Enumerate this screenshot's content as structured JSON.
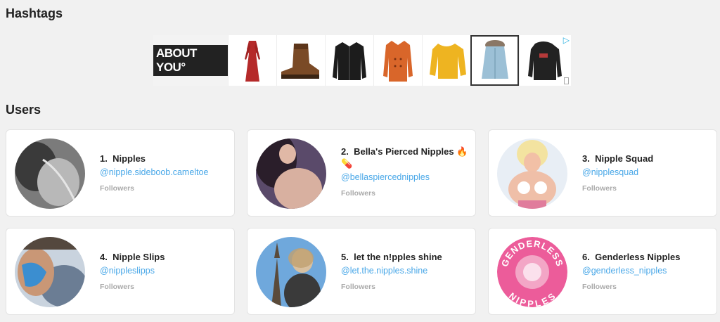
{
  "sections": {
    "hashtags_title": "Hashtags",
    "users_title": "Users"
  },
  "ad": {
    "brand_logo": "ABOUT YOU°",
    "items": [
      "red-dress",
      "brown-boot",
      "black-leather-jacket",
      "orange-coat",
      "yellow-sweater",
      "light-blue-parka",
      "black-winter-jacket"
    ],
    "selected_index": 5
  },
  "users": [
    {
      "rank": "1.",
      "name": "Nipples",
      "handle": "@nipple.sideboob.cameltoe",
      "followers_label": "Followers"
    },
    {
      "rank": "2.",
      "name": "Bella's Pierced Nipples 🔥 💊",
      "handle": "@bellaspiercednipples",
      "followers_label": "Followers"
    },
    {
      "rank": "3.",
      "name": "Nipple Squad",
      "handle": "@nipplesquad",
      "followers_label": "Followers"
    },
    {
      "rank": "4.",
      "name": "Nipple Slips",
      "handle": "@nippleslipps",
      "followers_label": "Followers"
    },
    {
      "rank": "5.",
      "name": "let the n!pples shine",
      "handle": "@let.the.nipples.shine",
      "followers_label": "Followers"
    },
    {
      "rank": "6.",
      "name": "Genderless Nipples",
      "handle": "@genderless_nipples",
      "followers_label": "Followers"
    }
  ],
  "avatar6_text": "GENDERLESS NIPPLES",
  "colors": {
    "link": "#4aa8e8",
    "background": "#f1f1f1",
    "avatar6_pink": "#ec5c9a"
  }
}
